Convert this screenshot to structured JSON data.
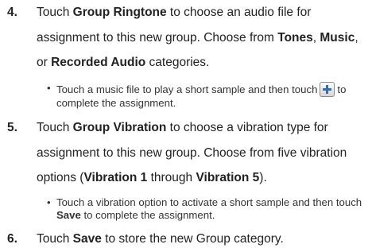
{
  "steps": [
    {
      "number": "4.",
      "line1_a": "Touch ",
      "line1_b": "Group Ringtone",
      "line1_c": " to choose an audio file for",
      "line2_a": "assignment to this new group. Choose from ",
      "line2_b": "Tones",
      "line2_c": ", ",
      "line2_d": "Music",
      "line2_e": ",",
      "line3_a": "or ",
      "line3_b": "Recorded Audio",
      "line3_c": " categories."
    },
    {
      "number": "5.",
      "line1_a": "Touch ",
      "line1_b": "Group Vibration",
      "line1_c": " to choose a vibration type for",
      "line2_a": "assignment to this new group. Choose from five vibration",
      "line3_a": "options (",
      "line3_b": "Vibration 1",
      "line3_c": " through ",
      "line3_d": "Vibration 5",
      "line3_e": ")."
    },
    {
      "number": "6.",
      "line1_a": "Touch ",
      "line1_b": "Save",
      "line1_c": " to store the new Group category."
    }
  ],
  "bullets": [
    {
      "dot": "•",
      "text_a": "Touch a music file to play a short sample and then touch",
      "icon": "plus-icon",
      "text_b": "to",
      "text_c": "complete the assignment."
    },
    {
      "dot": "•",
      "text_a": "Touch a vibration option to activate a short sample and then touch",
      "text_b": "Save",
      "text_c": " to complete the assignment."
    }
  ]
}
